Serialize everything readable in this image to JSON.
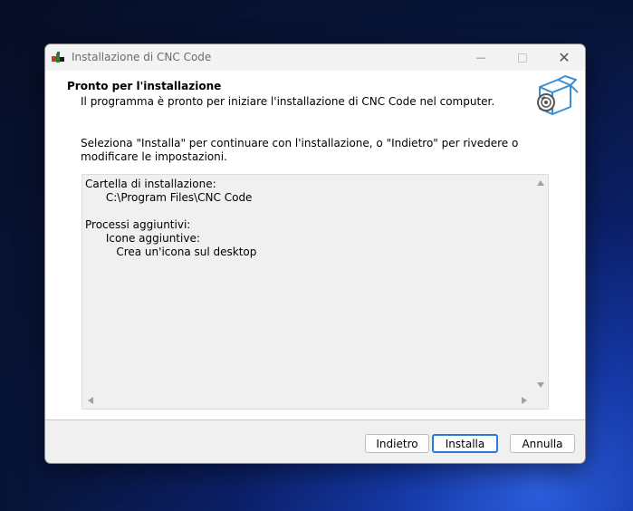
{
  "window": {
    "title": "Installazione di CNC Code",
    "controls": {
      "minimize": "—",
      "close": "✕"
    }
  },
  "header": {
    "title": "Pronto per l'installazione",
    "subtitle": "Il programma è pronto per iniziare l'installazione di CNC Code nel computer."
  },
  "instruction": "Seleziona \"Installa\" per continuare con l'installazione, o \"Indietro\" per rivedere o modificare le impostazioni.",
  "memo": {
    "lines": [
      "Cartella di installazione:",
      "      C:\\Program Files\\CNC Code",
      "",
      "Processi aggiuntivi:",
      "      Icone aggiuntive:",
      "         Crea un'icona sul desktop"
    ]
  },
  "buttons": {
    "back": "Indietro",
    "install": "Installa",
    "cancel": "Annulla"
  },
  "colors": {
    "accent": "#2a7ad6",
    "icon_blue": "#3a8fd6"
  },
  "icons": {
    "app": "installer-app-icon",
    "header": "package-box-cd-icon"
  }
}
